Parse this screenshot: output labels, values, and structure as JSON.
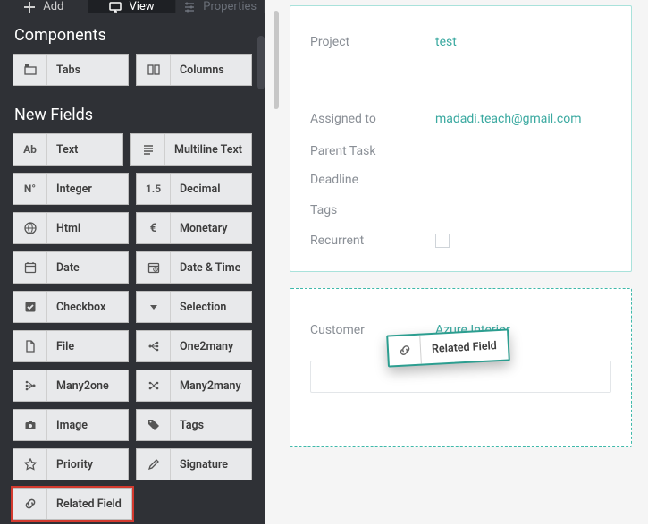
{
  "top_tabs": {
    "add": {
      "label": "Add",
      "icon": "plus-icon"
    },
    "view": {
      "label": "View",
      "icon": "monitor-icon"
    },
    "properties": {
      "label": "Properties",
      "icon": "sliders-icon"
    }
  },
  "sections": {
    "components_title": "Components",
    "new_fields_title": "New Fields"
  },
  "components": {
    "tabs": {
      "label": "Tabs",
      "icon": "tabs-icon"
    },
    "columns": {
      "label": "Columns",
      "icon": "columns-icon"
    }
  },
  "fields": {
    "text": {
      "label": "Text",
      "icon": "text-ab-icon"
    },
    "multiline": {
      "label": "Multiline Text",
      "icon": "lines-icon"
    },
    "integer": {
      "label": "Integer",
      "icon": "n-degree-icon"
    },
    "decimal": {
      "label": "Decimal",
      "icon": "one-five-icon"
    },
    "html": {
      "label": "Html",
      "icon": "globe-icon"
    },
    "monetary": {
      "label": "Monetary",
      "icon": "euro-icon"
    },
    "date": {
      "label": "Date",
      "icon": "calendar-icon"
    },
    "datetime": {
      "label": "Date & Time",
      "icon": "calendar-clock-icon"
    },
    "checkbox": {
      "label": "Checkbox",
      "icon": "checkbox-icon"
    },
    "selection": {
      "label": "Selection",
      "icon": "dropdown-icon"
    },
    "file": {
      "label": "File",
      "icon": "file-icon"
    },
    "one2many": {
      "label": "One2many",
      "icon": "one2many-icon"
    },
    "many2one": {
      "label": "Many2one",
      "icon": "many2one-icon"
    },
    "many2many": {
      "label": "Many2many",
      "icon": "many2many-icon"
    },
    "image": {
      "label": "Image",
      "icon": "camera-icon"
    },
    "tags": {
      "label": "Tags",
      "icon": "tag-icon"
    },
    "priority": {
      "label": "Priority",
      "icon": "star-icon"
    },
    "signature": {
      "label": "Signature",
      "icon": "pencil-icon"
    },
    "related": {
      "label": "Related Field",
      "icon": "link-icon"
    }
  },
  "form": {
    "project_label": "Project",
    "project_value": "test",
    "assigned_label": "Assigned to",
    "assigned_value": "madadi.teach@gmail.com",
    "parent_task_label": "Parent Task",
    "deadline_label": "Deadline",
    "tags_label": "Tags",
    "recurrent_label": "Recurrent",
    "customer_label": "Customer",
    "customer_value": "Azure Interior"
  },
  "drag_chip": {
    "label": "Related Field",
    "icon": "link-icon"
  },
  "colors": {
    "sidebar_bg": "#2f3136",
    "teal": "#3fb9aa",
    "muted": "#8a8f96",
    "highlight": "#d33a2f"
  }
}
